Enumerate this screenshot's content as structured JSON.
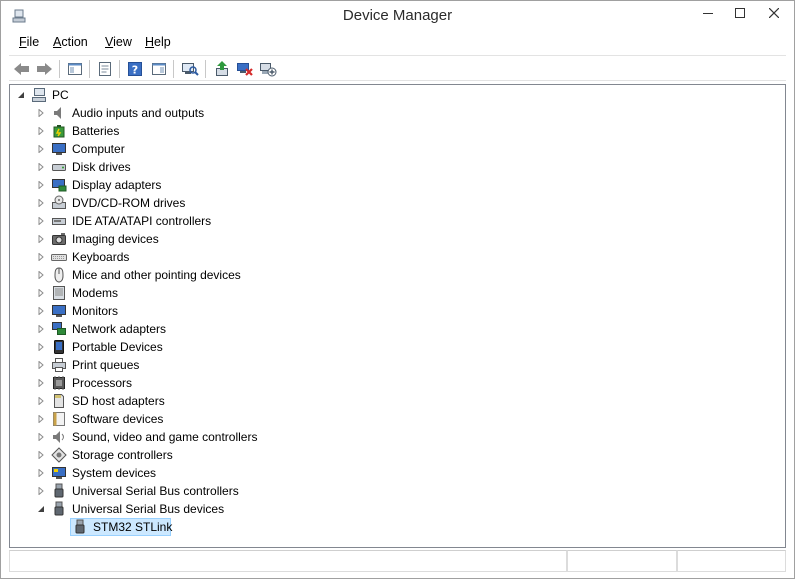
{
  "window": {
    "title": "Device Manager"
  },
  "menu": {
    "items": [
      {
        "mnemonic": "F",
        "rest": "ile"
      },
      {
        "mnemonic": "A",
        "rest": "ction"
      },
      {
        "mnemonic": "V",
        "rest": "iew"
      },
      {
        "mnemonic": "H",
        "rest": "elp"
      }
    ]
  },
  "toolbar": {
    "buttons": [
      "back-arrow-icon",
      "forward-arrow-icon",
      "show-hide-console-tree-icon",
      "properties-icon",
      "help-icon",
      "action-pane-icon",
      "scan-hardware-icon",
      "update-driver-icon",
      "uninstall-device-icon",
      "add-legacy-hardware-icon"
    ]
  },
  "tree": {
    "root": "PC",
    "categories": [
      "Audio inputs and outputs",
      "Batteries",
      "Computer",
      "Disk drives",
      "Display adapters",
      "DVD/CD-ROM drives",
      "IDE ATA/ATAPI controllers",
      "Imaging devices",
      "Keyboards",
      "Mice and other pointing devices",
      "Modems",
      "Monitors",
      "Network adapters",
      "Portable Devices",
      "Print queues",
      "Processors",
      "SD host adapters",
      "Software devices",
      "Sound, video and game controllers",
      "Storage controllers",
      "System devices",
      "Universal Serial Bus controllers",
      "Universal Serial Bus devices"
    ],
    "expanded_child": "STM32 STLink"
  },
  "colors": {
    "selection_bg": "#cce8ff",
    "selection_border": "#99d1ff",
    "panel_border": "#828790"
  }
}
